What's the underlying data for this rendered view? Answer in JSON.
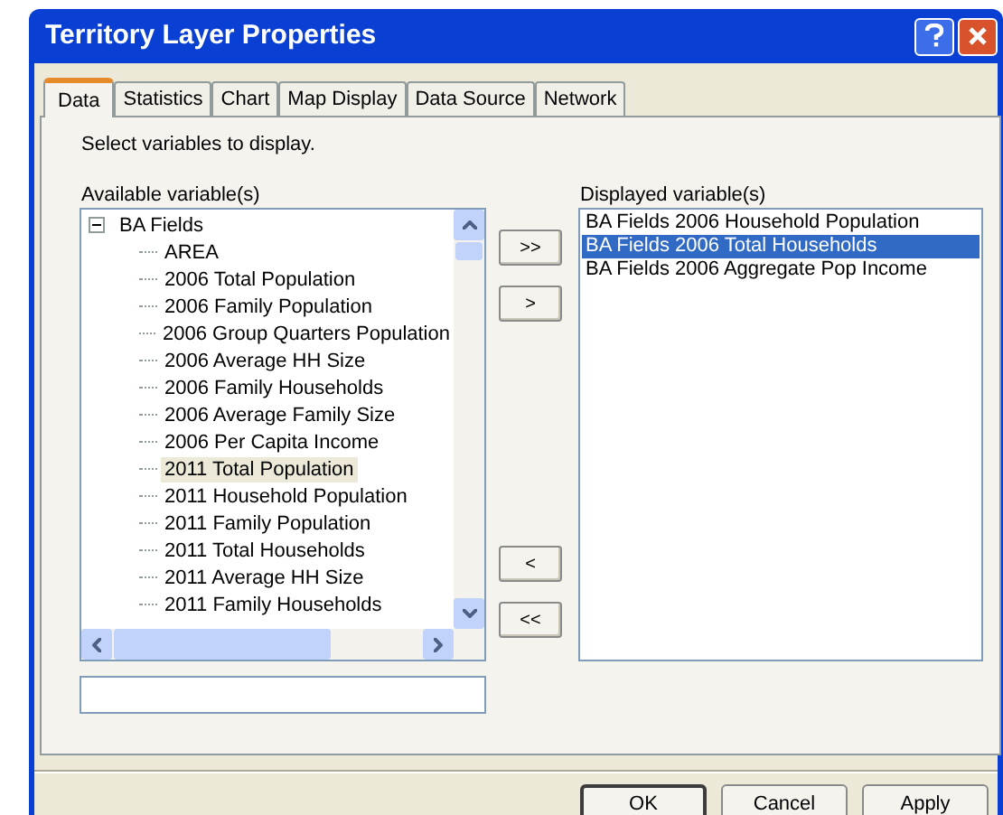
{
  "window": {
    "title": "Territory Layer Properties"
  },
  "tabs": [
    {
      "label": "Data",
      "selected": true
    },
    {
      "label": "Statistics",
      "selected": false
    },
    {
      "label": "Chart",
      "selected": false
    },
    {
      "label": "Map Display",
      "selected": false
    },
    {
      "label": "Data Source",
      "selected": false
    },
    {
      "label": "Network",
      "selected": false
    }
  ],
  "instruction": "Select variables to display.",
  "available": {
    "label": "Available variable(s)",
    "tree": [
      {
        "label": "BA Fields",
        "expanded": true,
        "selected": false,
        "children": [
          {
            "label": "AREA",
            "selected": false
          },
          {
            "label": "2006 Total Population",
            "selected": false
          },
          {
            "label": "2006 Family Population",
            "selected": false
          },
          {
            "label": "2006 Group Quarters Population",
            "selected": false
          },
          {
            "label": "2006 Average HH Size",
            "selected": false
          },
          {
            "label": "2006 Family Households",
            "selected": false
          },
          {
            "label": "2006 Average Family Size",
            "selected": false
          },
          {
            "label": "2006 Per Capita Income",
            "selected": false
          },
          {
            "label": "2011 Total Population",
            "selected": true
          },
          {
            "label": "2011 Household Population",
            "selected": false
          },
          {
            "label": "2011 Family Population",
            "selected": false
          },
          {
            "label": "2011 Total Households",
            "selected": false
          },
          {
            "label": "2011 Average HH Size",
            "selected": false
          },
          {
            "label": "2011 Family Households",
            "selected": false
          }
        ]
      }
    ]
  },
  "move_buttons_upper": [
    ">>",
    ">"
  ],
  "move_buttons_lower": [
    "<",
    "<<"
  ],
  "displayed": {
    "label": "Displayed variable(s)",
    "items": [
      {
        "label": "BA Fields 2006 Household Population",
        "selected": false
      },
      {
        "label": "BA Fields 2006 Total Households",
        "selected": true
      },
      {
        "label": "BA Fields 2006 Aggregate Pop Income",
        "selected": false
      }
    ]
  },
  "buttons": [
    {
      "label": "OK",
      "default": true
    },
    {
      "label": "Cancel",
      "default": false
    },
    {
      "label": "Apply",
      "default": false
    }
  ]
}
